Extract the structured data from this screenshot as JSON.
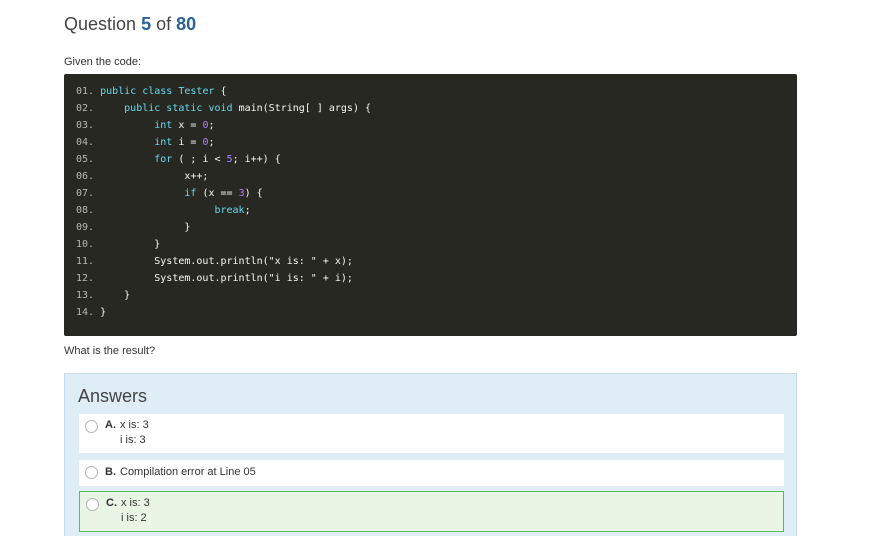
{
  "question": {
    "prefix": "Question",
    "number": "5",
    "of": "of",
    "total": "80"
  },
  "intro": "Given the code:",
  "code_lines": [
    {
      "n": "01.",
      "parts": [
        {
          "t": " public class ",
          "c": "kw"
        },
        {
          "t": "Tester",
          "c": "kw"
        },
        {
          "t": " {",
          "c": "tx"
        }
      ]
    },
    {
      "n": "02.",
      "parts": [
        {
          "t": "     public static void ",
          "c": "kw"
        },
        {
          "t": "main(String[ ] args) {",
          "c": "tx"
        }
      ]
    },
    {
      "n": "03.",
      "parts": [
        {
          "t": "          int ",
          "c": "kw"
        },
        {
          "t": "x = ",
          "c": "tx"
        },
        {
          "t": "0",
          "c": "nu"
        },
        {
          "t": ";",
          "c": "tx"
        }
      ]
    },
    {
      "n": "04.",
      "parts": [
        {
          "t": "          int ",
          "c": "kw"
        },
        {
          "t": "i = ",
          "c": "tx"
        },
        {
          "t": "0",
          "c": "nu"
        },
        {
          "t": ";",
          "c": "tx"
        }
      ]
    },
    {
      "n": "05.",
      "parts": [
        {
          "t": "          for ",
          "c": "kw"
        },
        {
          "t": "( ; i < ",
          "c": "tx"
        },
        {
          "t": "5",
          "c": "nu"
        },
        {
          "t": "; i++) {",
          "c": "tx"
        }
      ]
    },
    {
      "n": "06.",
      "parts": [
        {
          "t": "               x++;",
          "c": "tx"
        }
      ]
    },
    {
      "n": "07.",
      "parts": [
        {
          "t": "               if ",
          "c": "kw"
        },
        {
          "t": "(x == ",
          "c": "tx"
        },
        {
          "t": "3",
          "c": "nu"
        },
        {
          "t": ") {",
          "c": "tx"
        }
      ]
    },
    {
      "n": "08.",
      "parts": [
        {
          "t": "                    break",
          "c": "kw"
        },
        {
          "t": ";",
          "c": "tx"
        }
      ]
    },
    {
      "n": "09.",
      "parts": [
        {
          "t": "               }",
          "c": "tx"
        }
      ]
    },
    {
      "n": "10.",
      "parts": [
        {
          "t": "          }",
          "c": "tx"
        }
      ]
    },
    {
      "n": "11.",
      "parts": [
        {
          "t": "          System.out.println(\"x is: \" + x);",
          "c": "tx"
        }
      ]
    },
    {
      "n": "12.",
      "parts": [
        {
          "t": "          System.out.println(\"i is: \" + i);",
          "c": "tx"
        }
      ]
    },
    {
      "n": "13.",
      "parts": [
        {
          "t": "     }",
          "c": "tx"
        }
      ]
    },
    {
      "n": "14.",
      "parts": [
        {
          "t": " }",
          "c": "tx"
        }
      ]
    }
  ],
  "prompt": "What is the result?",
  "answers": {
    "heading": "Answers",
    "options": [
      {
        "letter": "A.",
        "line1": "x is: 3",
        "line2": "i is: 3"
      },
      {
        "letter": "B.",
        "line1": "Compilation error at Line 05",
        "line2": ""
      },
      {
        "letter": "C.",
        "line1": "x is: 3",
        "line2": "i is: 2",
        "correct": true
      }
    ]
  }
}
